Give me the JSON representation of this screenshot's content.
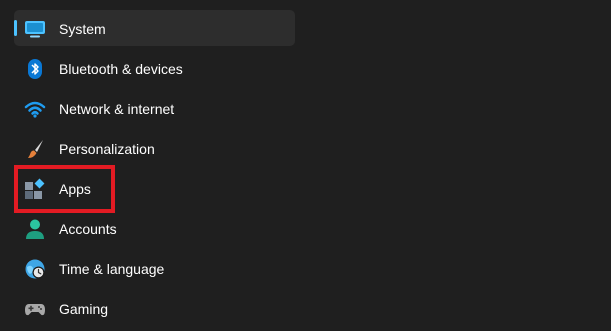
{
  "nav": {
    "selected": "System",
    "items": [
      {
        "label": "System",
        "icon": "monitor-icon"
      },
      {
        "label": "Bluetooth & devices",
        "icon": "bluetooth-icon"
      },
      {
        "label": "Network & internet",
        "icon": "wifi-icon"
      },
      {
        "label": "Personalization",
        "icon": "paintbrush-icon"
      },
      {
        "label": "Apps",
        "icon": "apps-icon"
      },
      {
        "label": "Accounts",
        "icon": "person-icon"
      },
      {
        "label": "Time & language",
        "icon": "clock-globe-icon"
      },
      {
        "label": "Gaming",
        "icon": "gamepad-icon"
      }
    ]
  },
  "annotation": {
    "target": "Apps",
    "color": "#e31b23"
  },
  "colors": {
    "background": "#1f1f1f",
    "selected_background": "#2d2d2d",
    "accent": "#4cc2ff"
  }
}
